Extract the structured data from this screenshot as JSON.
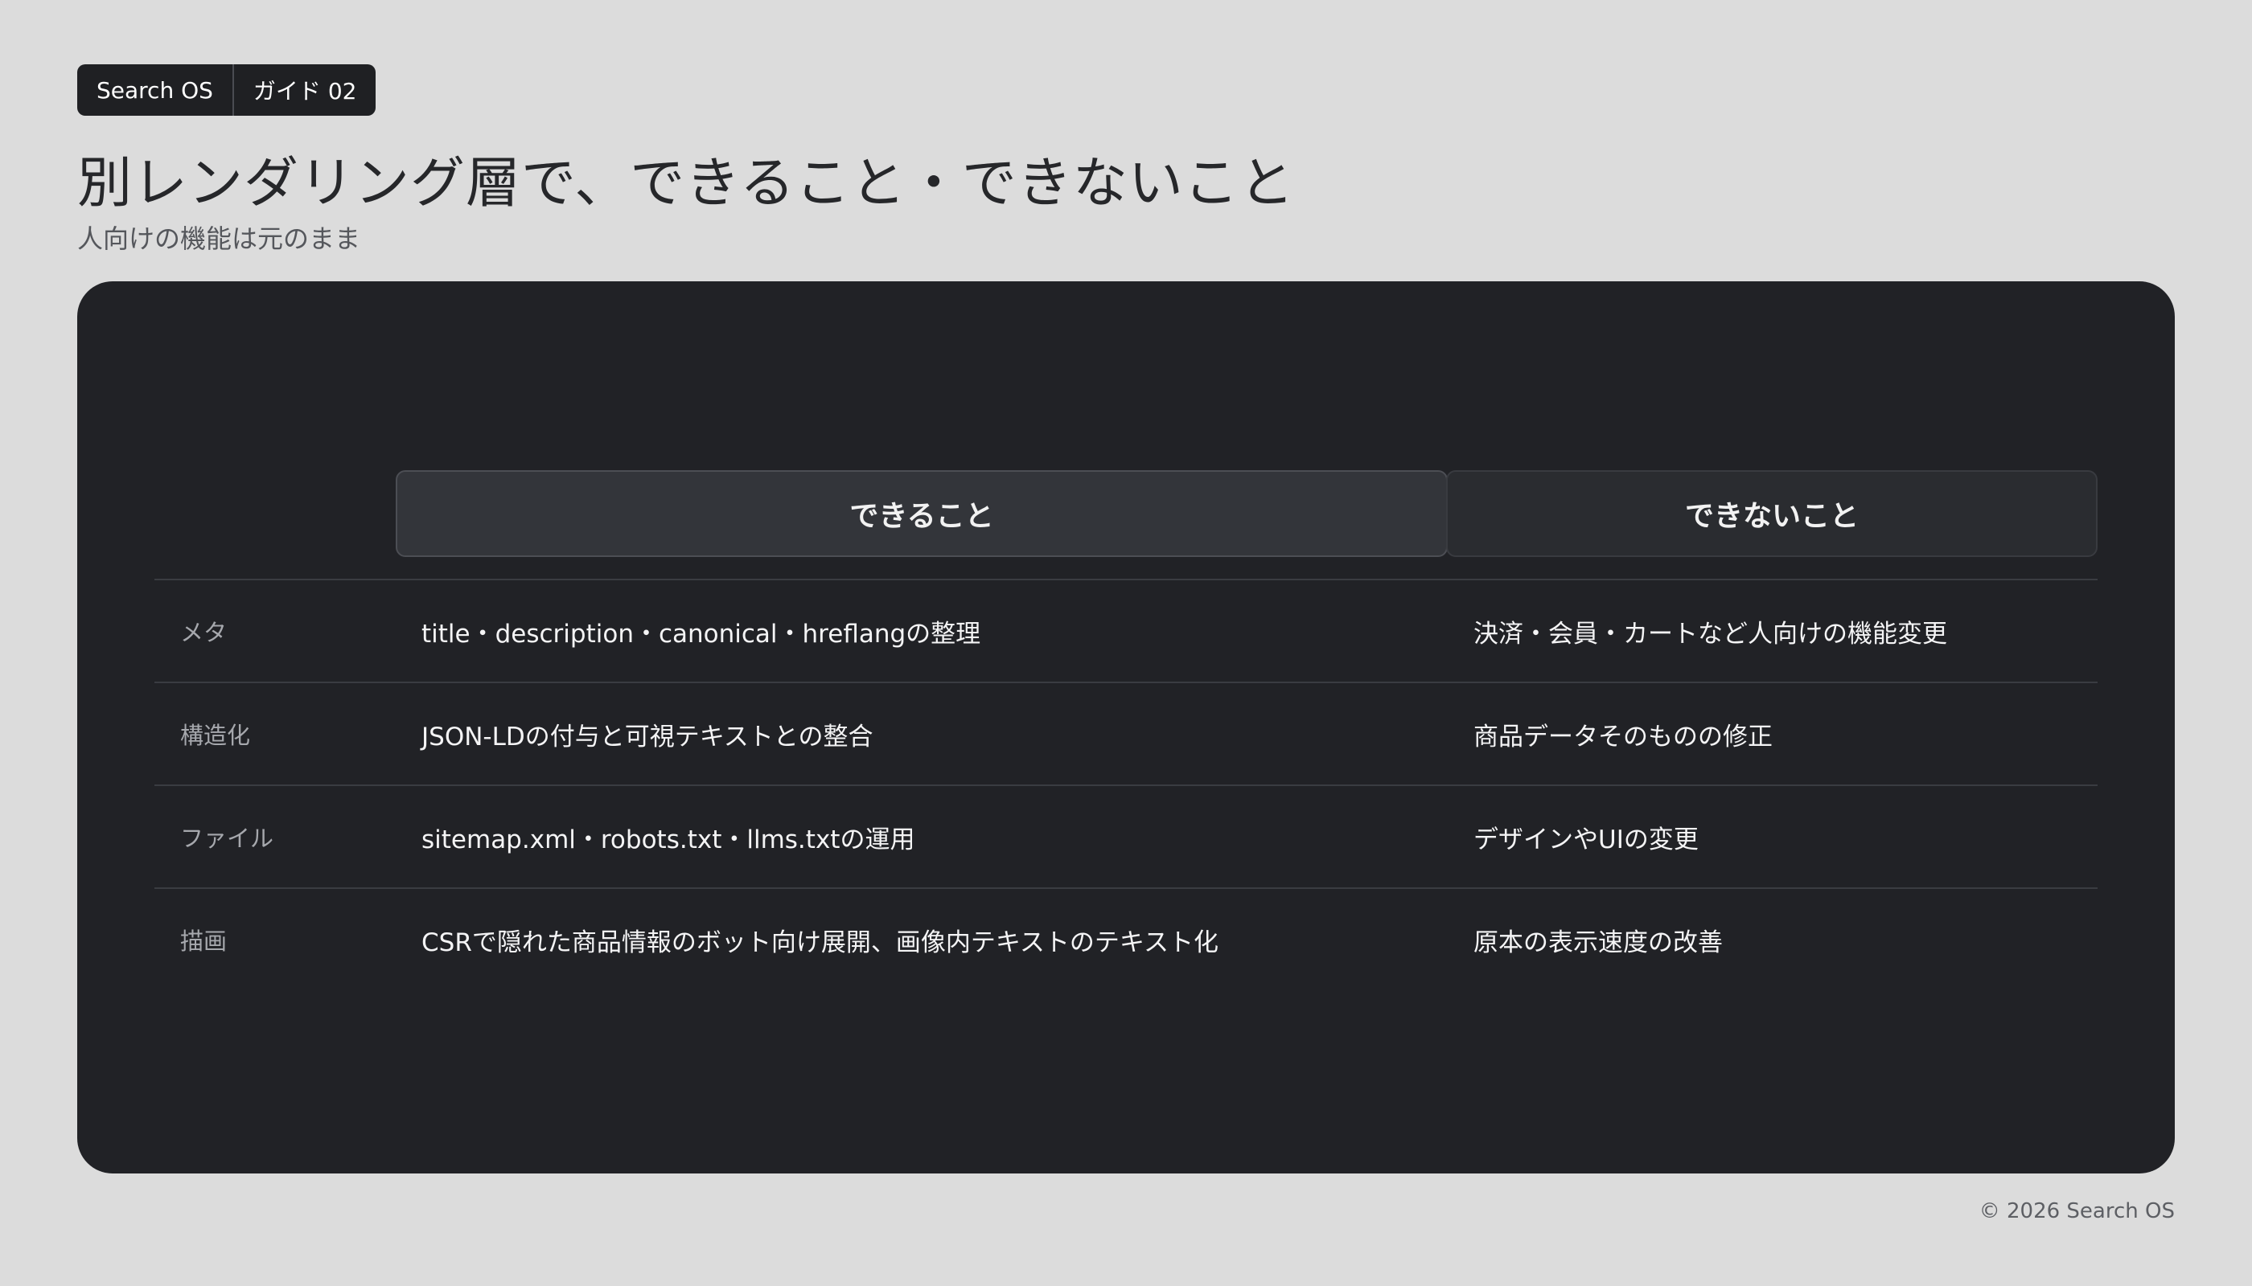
{
  "tags": [
    "Search OS",
    "ガイド 02"
  ],
  "title": "別レンダリング層で、できること・できないこと",
  "subtitle": "人向けの機能は元のまま",
  "table": {
    "headers": {
      "can": "できること",
      "cannot": "できないこと"
    },
    "rows": [
      {
        "label": "メタ",
        "can": "title・description・canonical・hreflangの整理",
        "cannot": "決済・会員・カートなど人向けの機能変更"
      },
      {
        "label": "構造化",
        "can": "JSON-LDの付与と可視テキストとの整合",
        "cannot": "商品データそのものの修正"
      },
      {
        "label": "ファイル",
        "can": "sitemap.xml・robots.txt・llms.txtの運用",
        "cannot": "デザインやUIの変更"
      },
      {
        "label": "描画",
        "can": "CSRで隠れた商品情報のボット向け展開、画像内テキストのテキスト化",
        "cannot": "原本の表示速度の改善"
      }
    ]
  },
  "footer": "© 2026 Search OS"
}
